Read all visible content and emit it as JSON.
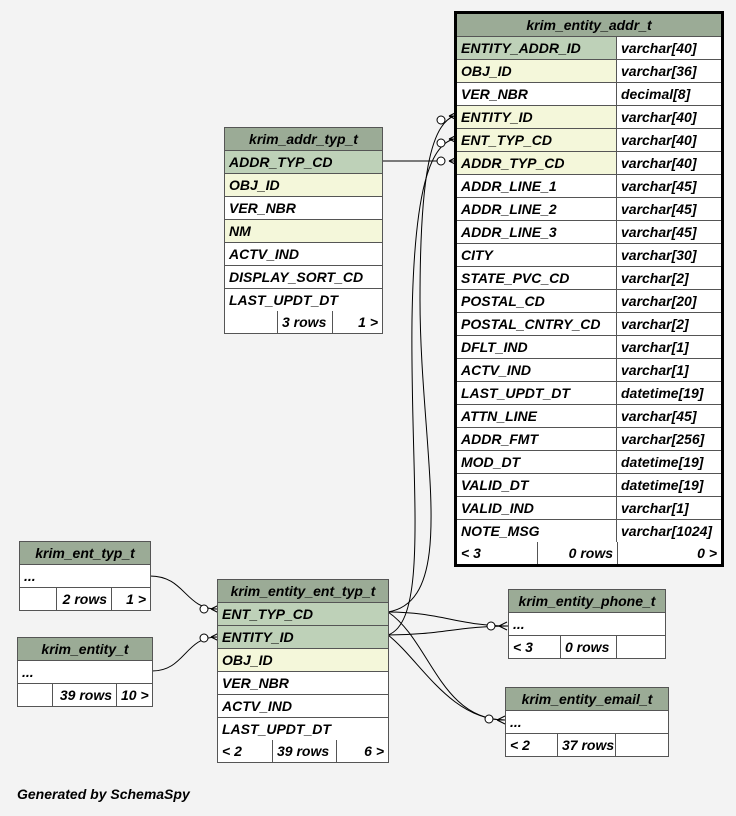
{
  "tables": {
    "entity_addr": {
      "name": "krim_entity_addr_t",
      "columns": [
        {
          "name": "ENTITY_ADDR_ID",
          "type": "varchar[40]",
          "kind": "pk"
        },
        {
          "name": "OBJ_ID",
          "type": "varchar[36]",
          "kind": "index"
        },
        {
          "name": "VER_NBR",
          "type": "decimal[8]",
          "kind": "plain"
        },
        {
          "name": "ENTITY_ID",
          "type": "varchar[40]",
          "kind": "index"
        },
        {
          "name": "ENT_TYP_CD",
          "type": "varchar[40]",
          "kind": "index"
        },
        {
          "name": "ADDR_TYP_CD",
          "type": "varchar[40]",
          "kind": "index"
        },
        {
          "name": "ADDR_LINE_1",
          "type": "varchar[45]",
          "kind": "plain"
        },
        {
          "name": "ADDR_LINE_2",
          "type": "varchar[45]",
          "kind": "plain"
        },
        {
          "name": "ADDR_LINE_3",
          "type": "varchar[45]",
          "kind": "plain"
        },
        {
          "name": "CITY",
          "type": "varchar[30]",
          "kind": "plain"
        },
        {
          "name": "STATE_PVC_CD",
          "type": "varchar[2]",
          "kind": "plain"
        },
        {
          "name": "POSTAL_CD",
          "type": "varchar[20]",
          "kind": "plain"
        },
        {
          "name": "POSTAL_CNTRY_CD",
          "type": "varchar[2]",
          "kind": "plain"
        },
        {
          "name": "DFLT_IND",
          "type": "varchar[1]",
          "kind": "plain"
        },
        {
          "name": "ACTV_IND",
          "type": "varchar[1]",
          "kind": "plain"
        },
        {
          "name": "LAST_UPDT_DT",
          "type": "datetime[19]",
          "kind": "plain"
        },
        {
          "name": "ATTN_LINE",
          "type": "varchar[45]",
          "kind": "plain"
        },
        {
          "name": "ADDR_FMT",
          "type": "varchar[256]",
          "kind": "plain"
        },
        {
          "name": "MOD_DT",
          "type": "datetime[19]",
          "kind": "plain"
        },
        {
          "name": "VALID_DT",
          "type": "datetime[19]",
          "kind": "plain"
        },
        {
          "name": "VALID_IND",
          "type": "varchar[1]",
          "kind": "plain"
        },
        {
          "name": "NOTE_MSG",
          "type": "varchar[1024]",
          "kind": "plain"
        }
      ],
      "footer": {
        "parents": "< 3",
        "rows": "0 rows",
        "children": "0 >"
      }
    },
    "addr_typ": {
      "name": "krim_addr_typ_t",
      "columns": [
        {
          "name": "ADDR_TYP_CD",
          "kind": "pk"
        },
        {
          "name": "OBJ_ID",
          "kind": "index"
        },
        {
          "name": "VER_NBR",
          "kind": "plain"
        },
        {
          "name": "NM",
          "kind": "index"
        },
        {
          "name": "ACTV_IND",
          "kind": "plain"
        },
        {
          "name": "DISPLAY_SORT_CD",
          "kind": "plain"
        },
        {
          "name": "LAST_UPDT_DT",
          "kind": "plain"
        }
      ],
      "footer": {
        "parents": "",
        "rows": "3 rows",
        "children": "1 >"
      }
    },
    "ent_typ": {
      "name": "krim_ent_typ_t",
      "ellipsis": "...",
      "footer": {
        "parents": "",
        "rows": "2 rows",
        "children": "1 >"
      }
    },
    "entity": {
      "name": "krim_entity_t",
      "ellipsis": "...",
      "footer": {
        "parents": "",
        "rows": "39 rows",
        "children": "10 >"
      }
    },
    "entity_ent_typ": {
      "name": "krim_entity_ent_typ_t",
      "columns": [
        {
          "name": "ENT_TYP_CD",
          "kind": "pk"
        },
        {
          "name": "ENTITY_ID",
          "kind": "pk"
        },
        {
          "name": "OBJ_ID",
          "kind": "index"
        },
        {
          "name": "VER_NBR",
          "kind": "plain"
        },
        {
          "name": "ACTV_IND",
          "kind": "plain"
        },
        {
          "name": "LAST_UPDT_DT",
          "kind": "plain"
        }
      ],
      "footer": {
        "parents": "< 2",
        "rows": "39 rows",
        "children": "6 >"
      }
    },
    "entity_phone": {
      "name": "krim_entity_phone_t",
      "ellipsis": "...",
      "footer": {
        "parents": "< 3",
        "rows": "0 rows",
        "children": ""
      }
    },
    "entity_email": {
      "name": "krim_entity_email_t",
      "ellipsis": "...",
      "footer": {
        "parents": "< 2",
        "rows": "37 rows",
        "children": ""
      }
    }
  },
  "generated_by": "Generated by SchemaSpy",
  "colors": {
    "background": "#f3f3f3",
    "header": "#9bab96",
    "primary_key": "#bed1b8",
    "indexed": "#f4f7da",
    "plain": "#ffffff",
    "line": "#000000"
  }
}
